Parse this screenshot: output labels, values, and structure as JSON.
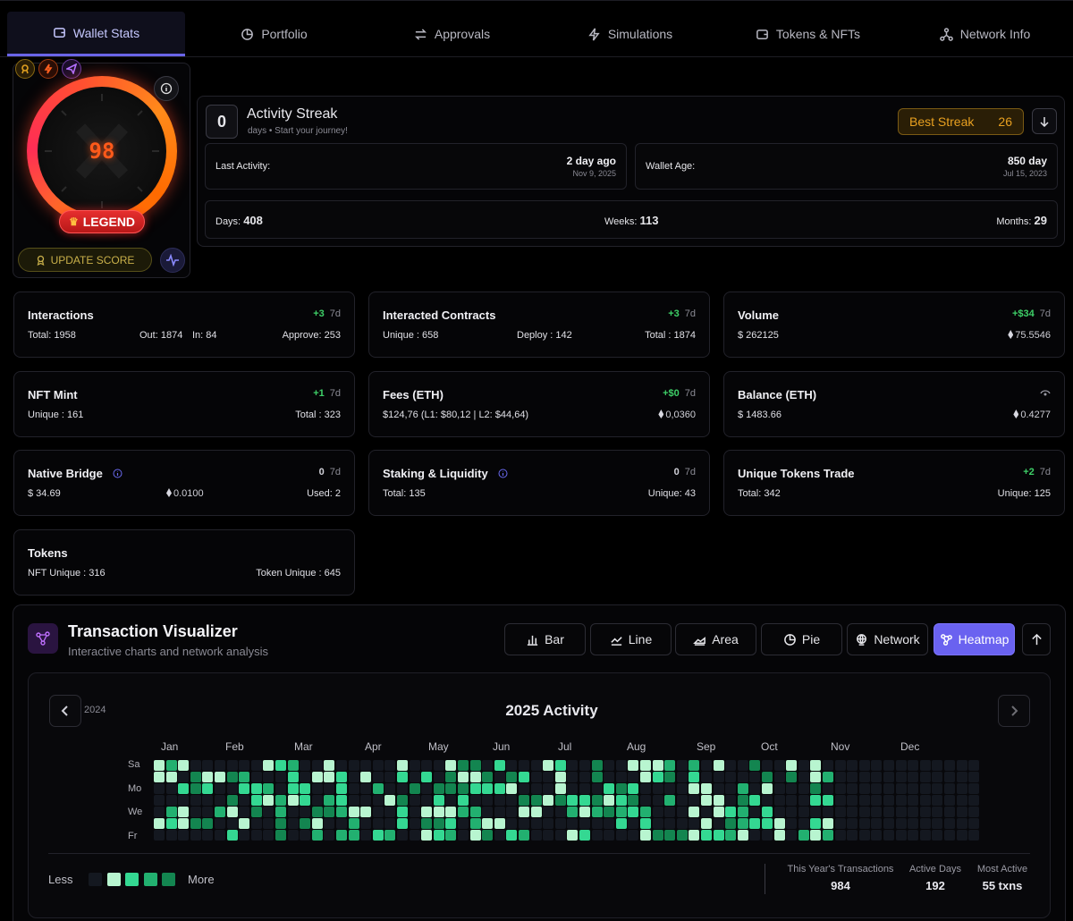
{
  "tabs": [
    {
      "label": "Wallet Stats",
      "icon": "wallet-icon",
      "active": true
    },
    {
      "label": "Portfolio",
      "icon": "pie-chart-icon"
    },
    {
      "label": "Approvals",
      "icon": "swap-arrows-icon"
    },
    {
      "label": "Simulations",
      "icon": "lightning-icon"
    },
    {
      "label": "Tokens & NFTs",
      "icon": "wallet-icon"
    },
    {
      "label": "Network Info",
      "icon": "network-icon"
    }
  ],
  "score": {
    "value": "98",
    "legend": "LEGEND",
    "update": "UPDATE SCORE",
    "ring_color": "#ff4a2a"
  },
  "streak": {
    "count": "0",
    "title": "Activity Streak",
    "subtitle": "days • Start your journey!",
    "best_label": "Best Streak",
    "best_value": "26",
    "last_activity_label": "Last Activity:",
    "last_activity_value": "2 day ago",
    "last_activity_date": "Nov 9, 2025",
    "wallet_age_label": "Wallet Age:",
    "wallet_age_value": "850 day",
    "wallet_age_date": "Jul 15, 2023",
    "days_label": "Days:",
    "days_value": "408",
    "weeks_label": "Weeks:",
    "weeks_value": "113",
    "months_label": "Months:",
    "months_value": "29"
  },
  "stats": [
    {
      "title": "Interactions",
      "delta": "+3",
      "period": "7d",
      "fields": [
        "Total: 1958",
        "Out: 1874",
        "In: 84",
        "Approve: 253"
      ]
    },
    {
      "title": "Interacted Contracts",
      "delta": "+3",
      "period": "7d",
      "fields": [
        "Unique : 658",
        "Deploy : 142",
        "Total : 1874"
      ]
    },
    {
      "title": "Volume",
      "delta": "+$34",
      "period": "7d",
      "fields": [
        "$ 262125",
        "75.5546"
      ]
    },
    {
      "title": "NFT Mint",
      "delta": "+1",
      "period": "7d",
      "fields": [
        "Unique : 161",
        "Total : 323"
      ]
    },
    {
      "title": "Fees (ETH)",
      "delta": "+$0",
      "period": "7d",
      "fields": [
        "$124,76 (L1: $80,12 | L2: $44,64)",
        "0,0360"
      ]
    },
    {
      "title": "Balance (ETH)",
      "delta": "",
      "period": "",
      "fields": [
        "$ 1483.66",
        "0.4277"
      ]
    },
    {
      "title": "Native Bridge",
      "delta": "0",
      "period": "7d",
      "fields": [
        "$ 34.69",
        "0.0100",
        "Used: 2"
      ]
    },
    {
      "title": "Staking & Liquidity",
      "delta": "0",
      "period": "7d",
      "fields": [
        "Total: 135",
        "Unique: 43"
      ]
    },
    {
      "title": "Unique Tokens Trade",
      "delta": "+2",
      "period": "7d",
      "fields": [
        "Total: 342",
        "Unique: 125"
      ]
    },
    {
      "title": "Tokens",
      "delta": "",
      "period": "",
      "fields": [
        "NFT Unique : 316",
        "Token Unique : 645"
      ]
    }
  ],
  "visualizer": {
    "title": "Transaction Visualizer",
    "subtitle": "Interactive charts and network analysis",
    "buttons": [
      "Bar",
      "Line",
      "Area",
      "Pie",
      "Network",
      "Heatmap"
    ],
    "active": "Heatmap"
  },
  "heatmap": {
    "prev_year": "2024",
    "title": "2025 Activity",
    "months": [
      "Jan",
      "Feb",
      "Mar",
      "Apr",
      "May",
      "Jun",
      "Jul",
      "Aug",
      "Sep",
      "Oct",
      "Nov",
      "Dec"
    ],
    "days": [
      "Sa",
      "Mo",
      "We",
      "Fr"
    ],
    "less": "Less",
    "more": "More",
    "colors": [
      "#141820",
      "#b8f5d0",
      "#34d892",
      "#22b070",
      "#138550"
    ],
    "footer": [
      {
        "label": "This Year's Transactions",
        "value": "984"
      },
      {
        "label": "Active Days",
        "value": "192"
      },
      {
        "label": "Most Active",
        "value": "55 txns"
      }
    ]
  }
}
